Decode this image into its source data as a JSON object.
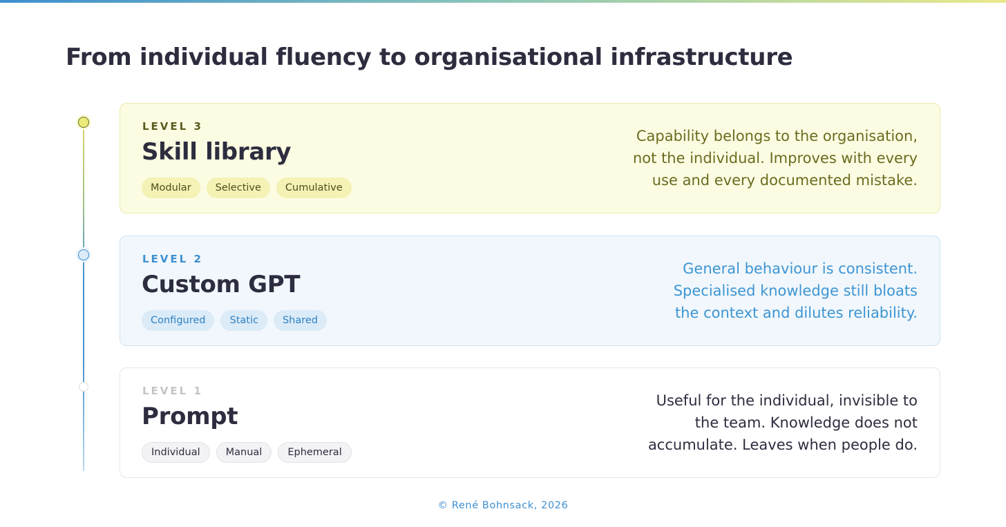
{
  "page": {
    "title": "From individual fluency to organisational infrastructure",
    "footer": "© René Bohnsack, 2026"
  },
  "colors": {
    "level3_accent": "#ecea7a",
    "level2_accent": "#3d8fd0",
    "level1_accent": "#dcdcdc"
  },
  "levels": [
    {
      "label": "LEVEL 3",
      "title": "Skill library",
      "tags": [
        "Modular",
        "Selective",
        "Cumulative"
      ],
      "description": [
        "Capability belongs to the organisation,",
        "not the individual. Improves with every",
        "use and every documented mistake."
      ]
    },
    {
      "label": "LEVEL 2",
      "title": "Custom GPT",
      "tags": [
        "Configured",
        "Static",
        "Shared"
      ],
      "description": [
        "General behaviour is consistent.",
        "Specialised knowledge still bloats",
        "the context and dilutes reliability."
      ]
    },
    {
      "label": "LEVEL 1",
      "title": "Prompt",
      "tags": [
        "Individual",
        "Manual",
        "Ephemeral"
      ],
      "description": [
        "Useful for the individual, invisible to",
        "the team. Knowledge does not",
        "accumulate. Leaves when people do."
      ]
    }
  ]
}
